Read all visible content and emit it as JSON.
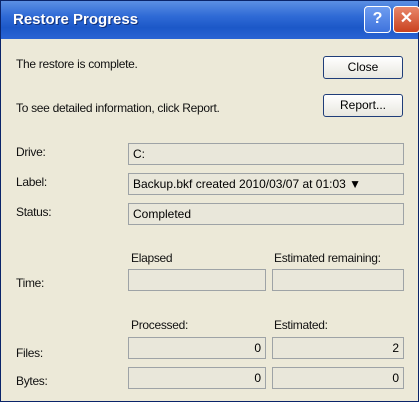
{
  "window": {
    "title": "Restore Progress"
  },
  "message": {
    "complete": "The restore is complete.",
    "report_hint": "To see detailed information, click Report."
  },
  "buttons": {
    "close": "Close",
    "report": "Report..."
  },
  "details": {
    "drive_label": "Drive:",
    "drive_value": "C:",
    "label_label": "Label:",
    "label_value": "Backup.bkf created 2010/03/07 at 01:03 ▼",
    "status_label": "Status:",
    "status_value": "Completed"
  },
  "time": {
    "row_label": "Time:",
    "elapsed_header": "Elapsed",
    "remaining_header": "Estimated remaining:",
    "elapsed_value": "",
    "remaining_value": ""
  },
  "counts": {
    "processed_header": "Processed:",
    "estimated_header": "Estimated:",
    "files_label": "Files:",
    "files_processed": "0",
    "files_estimated": "2",
    "bytes_label": "Bytes:",
    "bytes_processed": "0",
    "bytes_estimated": "0"
  },
  "icons": {
    "help": "question-icon",
    "close": "close-x-icon",
    "dropdown": "chevron-down-icon"
  },
  "colors": {
    "titlebar": "#2f6ad6",
    "close_button": "#c9421f",
    "dialog_bg": "#ece9d8"
  }
}
